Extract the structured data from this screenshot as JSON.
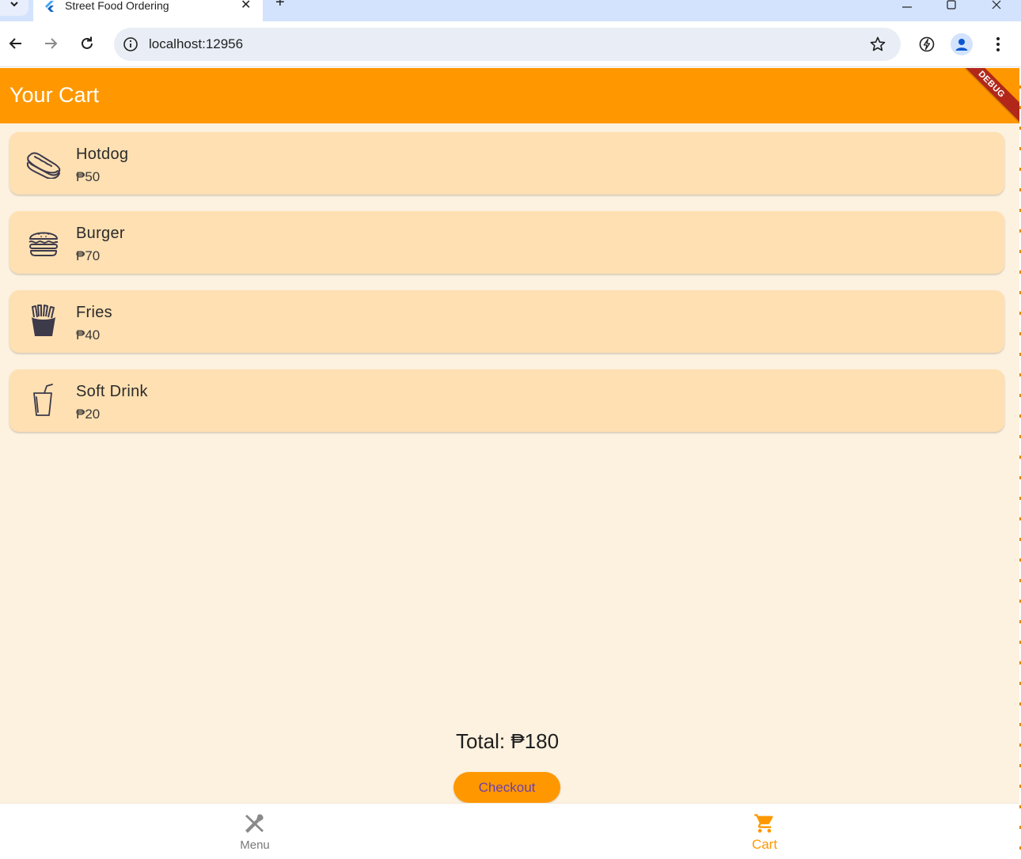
{
  "browser": {
    "tab_title": "Street Food Ordering",
    "url": "localhost:12956"
  },
  "app": {
    "title": "Your Cart",
    "debug_label": "DEBUG",
    "accent_color": "#ff9800",
    "items": [
      {
        "name": "Hotdog",
        "price": "₱50",
        "icon": "hotdog-icon"
      },
      {
        "name": "Burger",
        "price": "₱70",
        "icon": "burger-icon"
      },
      {
        "name": "Fries",
        "price": "₱40",
        "icon": "fries-icon"
      },
      {
        "name": "Soft Drink",
        "price": "₱20",
        "icon": "soft-drink-icon"
      }
    ],
    "total": "Total: ₱180",
    "checkout_label": "Checkout",
    "nav": {
      "menu_label": "Menu",
      "cart_label": "Cart",
      "active": "Cart"
    }
  }
}
